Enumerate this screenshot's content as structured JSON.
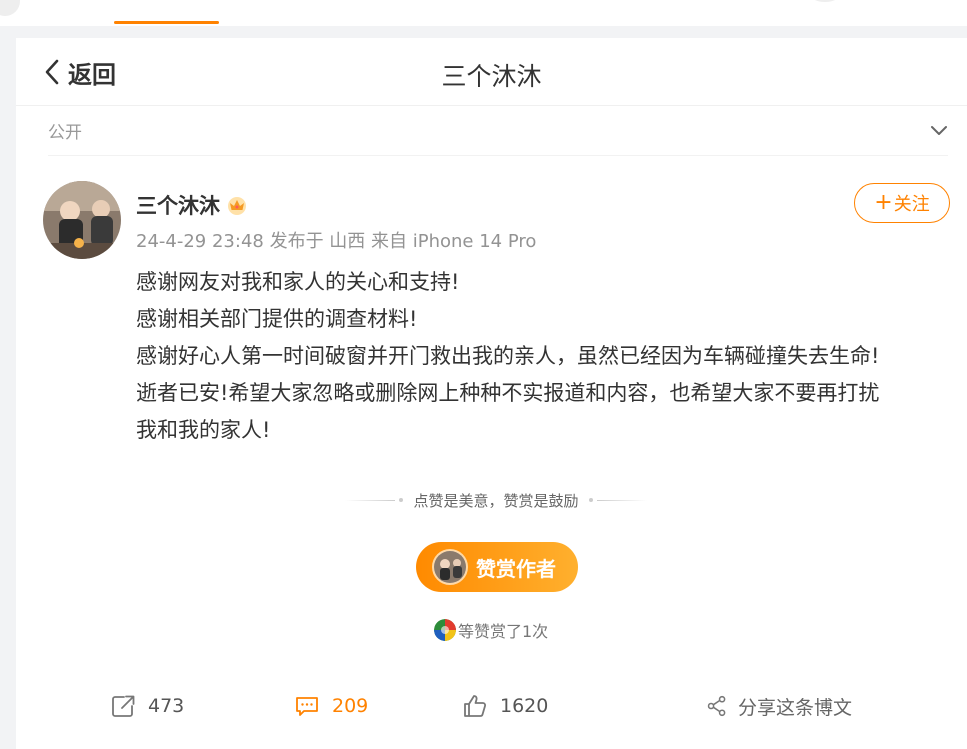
{
  "header": {
    "back_label": "返回",
    "title": "三个沐沐"
  },
  "visibility": {
    "label": "公开"
  },
  "post": {
    "author": "三个沐沐",
    "meta": "24-4-29 23:48 发布于 山西 来自 iPhone 14 Pro",
    "follow_label": "关注",
    "paragraphs": [
      "感谢网友对我和家人的关心和支持!",
      "感谢相关部门提供的调查材料!",
      "感谢好心人第一时间破窗并开门救出我的亲人，虽然已经因为车辆碰撞失去生命!",
      "逝者已安!希望大家忽略或删除网上种种不实报道和内容，也希望大家不要再打扰",
      "我和我的家人!"
    ]
  },
  "reward": {
    "tagline": "点赞是美意，赞赏是鼓励",
    "button_label": "赞赏作者",
    "rewarded_text": "等赞赏了1次"
  },
  "actions": {
    "forward_count": "473",
    "comment_count": "209",
    "like_count": "1620",
    "share_label": "分享这条博文"
  },
  "colors": {
    "accent": "#ff8200",
    "muted": "#939393"
  },
  "icons": {
    "back": "chevron-left-icon",
    "expand": "chevron-down-icon",
    "badge": "crown-icon",
    "forward": "forward-icon",
    "comment": "comment-icon",
    "like": "thumbs-up-icon",
    "share": "share-icon"
  }
}
